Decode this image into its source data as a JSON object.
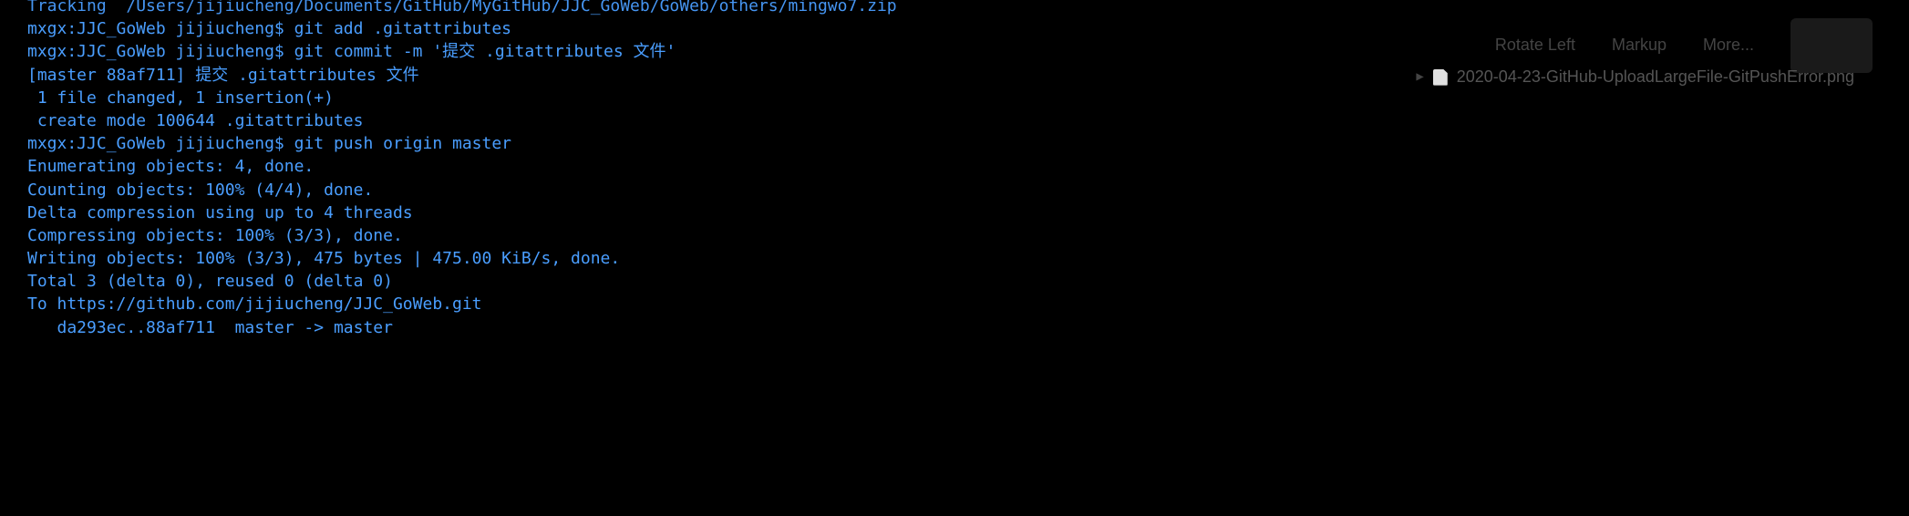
{
  "terminal": {
    "cutTopLine": "Tracking  /Users/jijiucheng/Documents/GitHub/MyGitHub/JJC_GoWeb/GoWeb/others/mingwo7.zip",
    "lines": [
      {
        "prompt": "mxgx:JJC_GoWeb jijiucheng$ ",
        "command": "git add .gitattributes"
      },
      {
        "prompt": "mxgx:JJC_GoWeb jijiucheng$ ",
        "command": "git commit -m '提交 .gitattributes 文件'"
      },
      {
        "output": "[master 88af711] 提交 .gitattributes 文件"
      },
      {
        "output": " 1 file changed, 1 insertion(+)"
      },
      {
        "output": " create mode 100644 .gitattributes"
      },
      {
        "prompt": "mxgx:JJC_GoWeb jijiucheng$ ",
        "command": "git push origin master"
      },
      {
        "output": "Enumerating objects: 4, done."
      },
      {
        "output": "Counting objects: 100% (4/4), done."
      },
      {
        "output": "Delta compression using up to 4 threads"
      },
      {
        "output": "Compressing objects: 100% (3/3), done."
      },
      {
        "output": "Writing objects: 100% (3/3), 475 bytes | 475.00 KiB/s, done."
      },
      {
        "output": "Total 3 (delta 0), reused 0 (delta 0)"
      },
      {
        "output": "To https://github.com/jijiucheng/JJC_GoWeb.git"
      },
      {
        "output": "   da293ec..88af711  master -> master"
      }
    ]
  },
  "toolbar": {
    "rotateLeft": "Rotate Left",
    "markup": "Markup",
    "more": "More..."
  },
  "fileRow": {
    "arrow": "▶",
    "fileName": "2020-04-23-GitHub-UploadLargeFile-GitPushError.png"
  }
}
